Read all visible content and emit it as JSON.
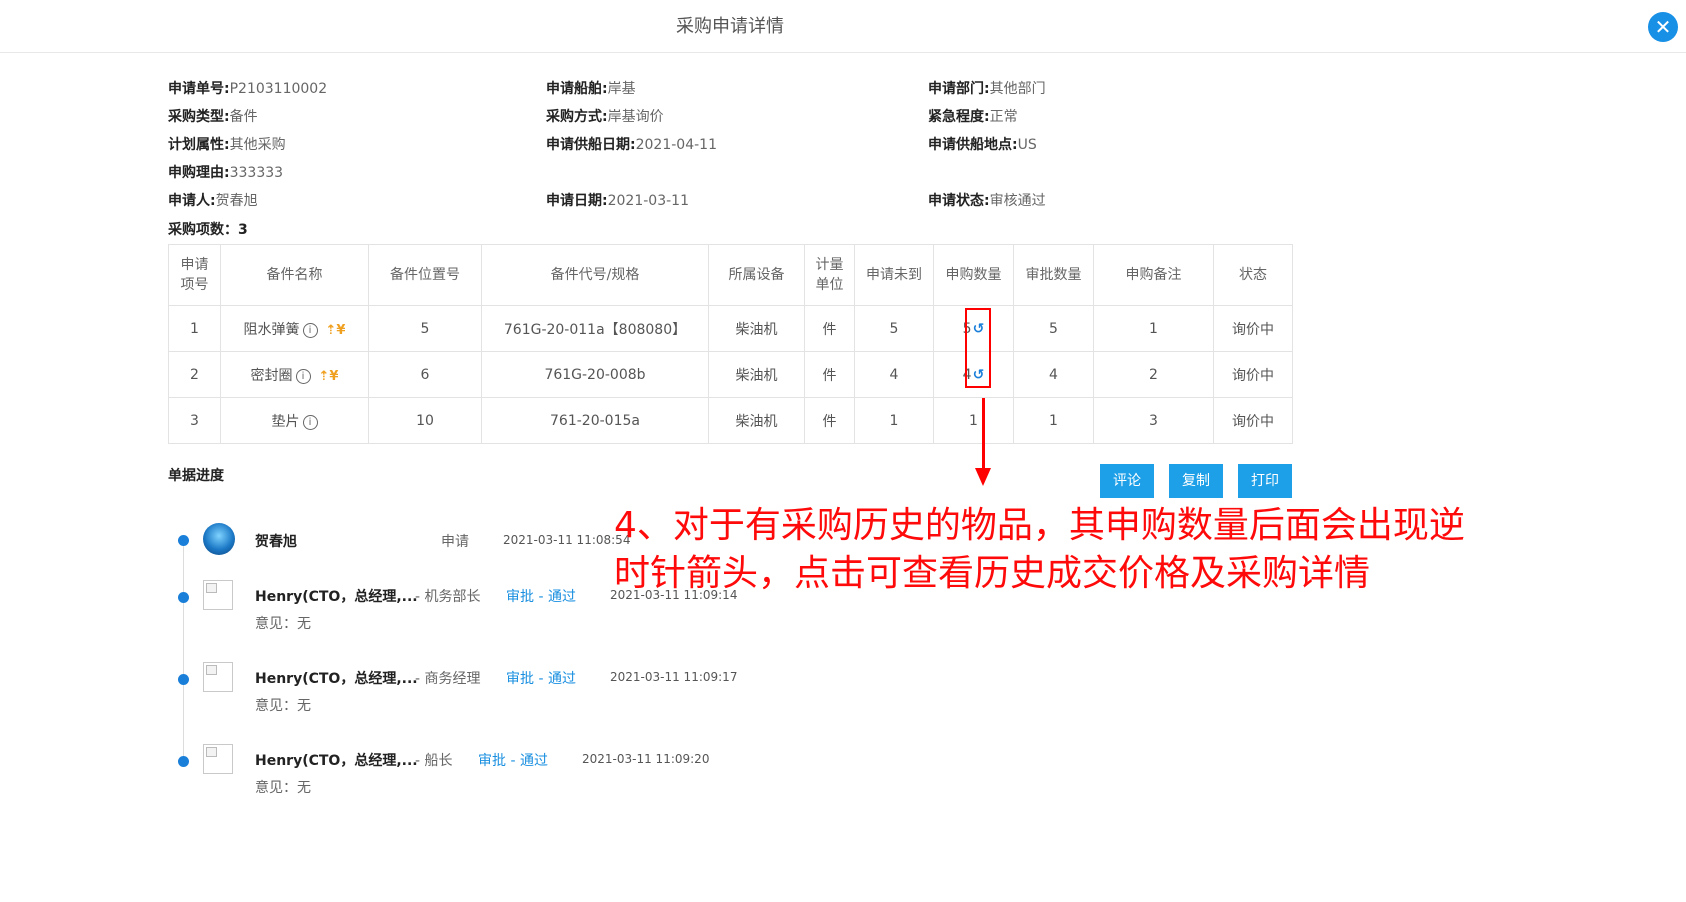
{
  "header": {
    "title": "采购申请详情",
    "close_icon": "close-icon"
  },
  "fields": {
    "order_no": {
      "label": "申请单号:",
      "value": "P2103110002"
    },
    "ship": {
      "label": "申请船舶:",
      "value": "岸基"
    },
    "dept": {
      "label": "申请部门:",
      "value": "其他部门"
    },
    "type": {
      "label": "采购类型:",
      "value": "备件"
    },
    "method": {
      "label": "采购方式:",
      "value": "岸基询价"
    },
    "urgency": {
      "label": "紧急程度:",
      "value": "正常"
    },
    "plan": {
      "label": "计划属性:",
      "value": "其他采购"
    },
    "supply_date": {
      "label": "申请供船日期:",
      "value": "2021-04-11"
    },
    "supply_loc": {
      "label": "申请供船地点:",
      "value": "US"
    },
    "reason": {
      "label": "申购理由:",
      "value": "333333"
    },
    "applicant": {
      "label": "申请人:",
      "value": "贺春旭"
    },
    "apply_date": {
      "label": "申请日期:",
      "value": "2021-03-11"
    },
    "status": {
      "label": "申请状态:",
      "value": "审核通过"
    }
  },
  "item_count": "采购项数：3",
  "table": {
    "headers": [
      "申请项号",
      "备件名称",
      "备件位置号",
      "备件代号/规格",
      "所属设备",
      "计量单位",
      "申请未到",
      "申购数量",
      "审批数量",
      "申购备注",
      "状态"
    ],
    "rows": [
      {
        "no": "1",
        "name": "阻水弹簧",
        "pos": "5",
        "code": "761G-20-011a【808080】",
        "equip": "柴油机",
        "unit": "件",
        "pending": "5",
        "qty": "5",
        "approved": "5",
        "note": "1",
        "status": "询价中"
      },
      {
        "no": "2",
        "name": "密封圈",
        "pos": "6",
        "code": "761G-20-008b",
        "equip": "柴油机",
        "unit": "件",
        "pending": "4",
        "qty": "4",
        "approved": "4",
        "note": "2",
        "status": "询价中"
      },
      {
        "no": "3",
        "name": "垫片",
        "pos": "10",
        "code": "761-20-015a",
        "equip": "柴油机",
        "unit": "件",
        "pending": "1",
        "qty": "1",
        "approved": "1",
        "note": "3",
        "status": "询价中"
      }
    ],
    "info_glyph": "i",
    "buy_glyph": "⇡¥",
    "history_glyph": "↺"
  },
  "progress": {
    "title": "单据进度",
    "buttons": {
      "comment": "评论",
      "copy": "复制",
      "print": "打印"
    },
    "entries": [
      {
        "name": "贺春旭",
        "role": "",
        "action": "申请",
        "time": "2021-03-11 11:08:54",
        "opinion": ""
      },
      {
        "name": "Henry(CTO，总经理,...",
        "role": "- 机务部长",
        "action": "审批 - 通过",
        "time": "2021-03-11 11:09:14",
        "opinion": "意见：无"
      },
      {
        "name": "Henry(CTO，总经理,...",
        "role": "- 商务经理",
        "action": "审批 - 通过",
        "time": "2021-03-11 11:09:17",
        "opinion": "意见：无"
      },
      {
        "name": "Henry(CTO，总经理,...",
        "role": "- 船长",
        "action": "审批 - 通过",
        "time": "2021-03-11 11:09:20",
        "opinion": "意见：无"
      }
    ]
  },
  "annotation": "4、对于有采购历史的物品，其申购数量后面会出现逆时针箭头，点击可查看历史成交价格及采购详情",
  "colors": {
    "accent": "#1ea0e8",
    "annotation": "#ff0a0a",
    "link": "#1a8fe0"
  }
}
